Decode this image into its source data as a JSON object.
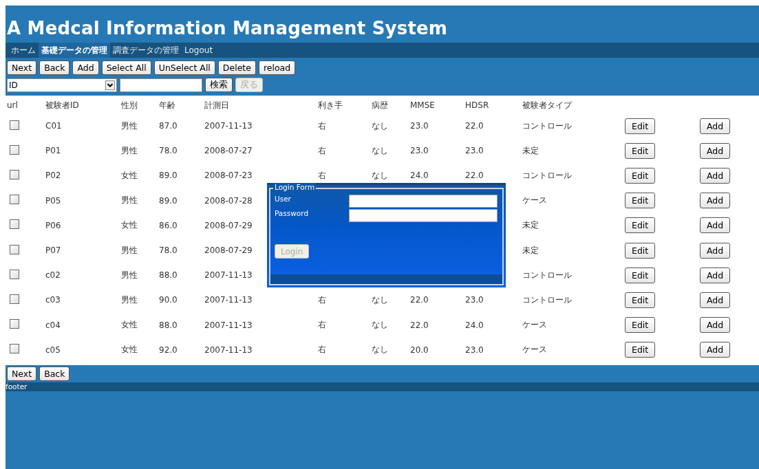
{
  "title": "A Medcal Information Management System",
  "nav": [
    {
      "label": "ホーム",
      "selected": false
    },
    {
      "label": "基礎データの管理",
      "selected": true
    },
    {
      "label": "調査データの管理",
      "selected": false
    },
    {
      "label": "Logout",
      "selected": false
    }
  ],
  "toolbar": [
    {
      "label": "Next"
    },
    {
      "label": "Back"
    },
    {
      "label": "Add"
    },
    {
      "label": "Select All"
    },
    {
      "label": "UnSelect All"
    },
    {
      "label": "Delete"
    },
    {
      "label": "reload"
    }
  ],
  "search": {
    "field": "ID",
    "buttons": [
      {
        "label": "検索",
        "disabled": false
      },
      {
        "label": "戻る",
        "disabled": true
      }
    ]
  },
  "table": {
    "columns": [
      "url",
      "被験者ID",
      "性別",
      "年齢",
      "計測日",
      "利き手",
      "病歴",
      "MMSE",
      "HDSR",
      "被験者タイプ"
    ],
    "rows": [
      {
        "checked": false,
        "id": "C01",
        "sex": "男性",
        "age": "87.0",
        "date": "2007-11-13",
        "hand": "右",
        "history": "なし",
        "mmse": "23.0",
        "hdsr": "22.0",
        "type": "コントロール",
        "edit": "Edit",
        "add": "Add"
      },
      {
        "checked": false,
        "id": "P01",
        "sex": "男性",
        "age": "78.0",
        "date": "2008-07-27",
        "hand": "右",
        "history": "なし",
        "mmse": "23.0",
        "hdsr": "23.0",
        "type": "未定",
        "edit": "Edit",
        "add": "Add"
      },
      {
        "checked": false,
        "id": "P02",
        "sex": "女性",
        "age": "89.0",
        "date": "2008-07-23",
        "hand": "右",
        "history": "なし",
        "mmse": "24.0",
        "hdsr": "22.0",
        "type": "コントロール",
        "edit": "Edit",
        "add": "Add"
      },
      {
        "checked": false,
        "id": "P05",
        "sex": "男性",
        "age": "89.0",
        "date": "2008-07-28",
        "type": "ケース",
        "edit": "Edit",
        "add": "Add"
      },
      {
        "checked": false,
        "id": "P06",
        "sex": "女性",
        "age": "86.0",
        "date": "2008-07-29",
        "type": "未定",
        "edit": "Edit",
        "add": "Add"
      },
      {
        "checked": false,
        "id": "P07",
        "sex": "男性",
        "age": "78.0",
        "date": "2008-07-29",
        "type": "未定",
        "edit": "Edit",
        "add": "Add"
      },
      {
        "checked": false,
        "id": "c02",
        "sex": "男性",
        "age": "88.0",
        "date": "2007-11-13",
        "type": "コントロール",
        "edit": "Edit",
        "add": "Add"
      },
      {
        "checked": false,
        "id": "c03",
        "sex": "男性",
        "age": "90.0",
        "date": "2007-11-13",
        "hand": "右",
        "history": "なし",
        "mmse": "22.0",
        "hdsr": "23.0",
        "type": "コントロール",
        "edit": "Edit",
        "add": "Add"
      },
      {
        "checked": false,
        "id": "c04",
        "sex": "女性",
        "age": "88.0",
        "date": "2007-11-13",
        "hand": "右",
        "history": "なし",
        "mmse": "22.0",
        "hdsr": "24.0",
        "type": "ケース",
        "edit": "Edit",
        "add": "Add"
      },
      {
        "checked": false,
        "id": "c05",
        "sex": "女性",
        "age": "92.0",
        "date": "2007-11-13",
        "hand": "右",
        "history": "なし",
        "mmse": "20.0",
        "hdsr": "23.0",
        "type": "ケース",
        "edit": "Edit",
        "add": "Add"
      }
    ]
  },
  "bottom_buttons": [
    {
      "label": "Next"
    },
    {
      "label": "Back"
    }
  ],
  "login_form": {
    "legend": "Login Form",
    "user_label": "User",
    "password_label": "Password",
    "button": {
      "label": "Login",
      "disabled": true
    }
  },
  "footer": "footer"
}
